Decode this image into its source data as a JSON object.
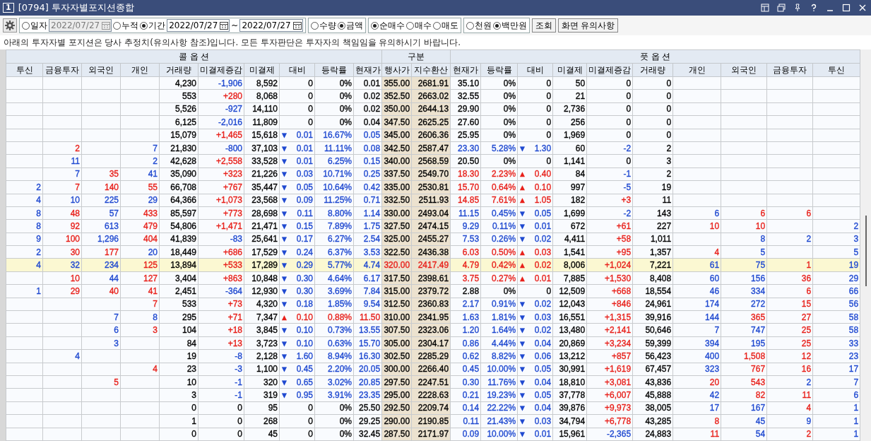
{
  "window": {
    "number": "1",
    "title": "[0794] 투자자별포지션종합"
  },
  "toolbar": {
    "groups": [
      {
        "items": [
          {
            "kind": "radio",
            "label": "일자",
            "selected": false
          },
          {
            "kind": "date",
            "value": "2022/07/27",
            "disabled": true
          },
          {
            "kind": "radio",
            "label": "누적",
            "selected": false
          },
          {
            "kind": "radio",
            "label": "기간",
            "selected": true
          },
          {
            "kind": "date",
            "value": "2022/07/27",
            "disabled": false
          },
          {
            "kind": "text",
            "label": "~"
          },
          {
            "kind": "date",
            "value": "2022/07/27",
            "disabled": false
          }
        ]
      },
      {
        "items": [
          {
            "kind": "radio",
            "label": "수량",
            "selected": false
          },
          {
            "kind": "radio",
            "label": "금액",
            "selected": true
          }
        ]
      },
      {
        "items": [
          {
            "kind": "radio",
            "label": "순매수",
            "selected": true
          },
          {
            "kind": "radio",
            "label": "매수",
            "selected": false
          },
          {
            "kind": "radio",
            "label": "매도",
            "selected": false
          }
        ]
      },
      {
        "items": [
          {
            "kind": "radio",
            "label": "천원",
            "selected": false
          },
          {
            "kind": "radio",
            "label": "백만원",
            "selected": true
          }
        ]
      }
    ],
    "buttons": [
      "조회",
      "화면 유의사항"
    ]
  },
  "notice": "아래의 투자자별 포지션은 당사 추정치(유의사항 참조)입니다. 모든 투자판단은 투자자의 책임임을 유의하시기 바랍니다.",
  "table": {
    "column_groups": [
      {
        "label": "콜 옵 션",
        "kind": "side",
        "columns": [
          "투신",
          "금융투자",
          "외국인",
          "개인",
          "거래량",
          "미결제증감",
          "미결제",
          "대비",
          "등락률",
          "현재가"
        ]
      },
      {
        "label": "구분",
        "kind": "strike",
        "columns": [
          "행사가",
          "지수환산"
        ]
      },
      {
        "label": "풋 옵 션",
        "kind": "side",
        "columns": [
          "현재가",
          "등락률",
          "대비",
          "미결제",
          "미결제증감",
          "거래량",
          "개인",
          "외국인",
          "금융투자",
          "투신"
        ]
      }
    ],
    "rows": [
      {
        "selected": false,
        "cells": [
          null,
          null,
          null,
          null,
          "4,230",
          {
            "text": "-1,906",
            "color": "#1f49d0"
          },
          "8,592",
          "0",
          "0%",
          "0.01",
          "355.00",
          "2681.91",
          "35.10",
          "0%",
          "0",
          "50",
          "0",
          "0",
          null,
          null,
          null,
          null
        ]
      },
      {
        "selected": false,
        "cells": [
          null,
          null,
          null,
          null,
          "553",
          {
            "text": "+280",
            "color": "#e8201a"
          },
          "8,068",
          "0",
          "0%",
          "0.02",
          "352.50",
          "2663.02",
          "32.55",
          "0%",
          "0",
          "21",
          "0",
          "0",
          null,
          null,
          null,
          null
        ]
      },
      {
        "selected": false,
        "cells": [
          null,
          null,
          null,
          null,
          "5,526",
          {
            "text": "-927",
            "color": "#1f49d0"
          },
          "14,110",
          "0",
          "0%",
          "0.02",
          "350.00",
          "2644.13",
          "29.90",
          "0%",
          "0",
          "2,736",
          "0",
          "0",
          null,
          null,
          null,
          null
        ]
      },
      {
        "selected": false,
        "cells": [
          null,
          null,
          null,
          null,
          "6,125",
          {
            "text": "-2,016",
            "color": "#1f49d0"
          },
          "11,809",
          "0",
          "0%",
          "0.04",
          "347.50",
          "2625.25",
          "27.60",
          "0%",
          "0",
          "256",
          "0",
          "0",
          null,
          null,
          null,
          null
        ]
      },
      {
        "selected": false,
        "cells": [
          null,
          null,
          null,
          null,
          "15,079",
          {
            "text": "+1,465",
            "color": "#e8201a"
          },
          "15,618",
          {
            "text": "0.01",
            "color": "#1f49d0",
            "arrow": "▼"
          },
          {
            "text": "16.67%",
            "color": "#1f49d0"
          },
          {
            "text": "0.05",
            "color": "#1f49d0"
          },
          "345.00",
          "2606.36",
          "25.95",
          "0%",
          "0",
          "1,969",
          "0",
          "0",
          null,
          null,
          null,
          null
        ]
      },
      {
        "selected": false,
        "cells": [
          null,
          {
            "text": "2",
            "color": "#e8201a"
          },
          null,
          {
            "text": "7",
            "color": "#1f49d0"
          },
          "21,830",
          {
            "text": "-800",
            "color": "#1f49d0"
          },
          "37,103",
          {
            "text": "0.01",
            "color": "#1f49d0",
            "arrow": "▼"
          },
          {
            "text": "11.11%",
            "color": "#1f49d0"
          },
          {
            "text": "0.08",
            "color": "#1f49d0"
          },
          "342.50",
          "2587.47",
          {
            "text": "23.30",
            "color": "#1f49d0"
          },
          {
            "text": "5.28%",
            "color": "#1f49d0"
          },
          {
            "text": "1.30",
            "color": "#1f49d0",
            "arrow": "▼"
          },
          "60",
          {
            "text": "-2",
            "color": "#1f49d0"
          },
          "2",
          null,
          null,
          null,
          null
        ]
      },
      {
        "selected": false,
        "cells": [
          null,
          {
            "text": "11",
            "color": "#1f49d0"
          },
          null,
          {
            "text": "2",
            "color": "#1f49d0"
          },
          "42,628",
          {
            "text": "+2,558",
            "color": "#e8201a"
          },
          "33,528",
          {
            "text": "0.01",
            "color": "#1f49d0",
            "arrow": "▼"
          },
          {
            "text": "6.25%",
            "color": "#1f49d0"
          },
          {
            "text": "0.15",
            "color": "#1f49d0"
          },
          "340.00",
          "2568.59",
          "20.50",
          "0%",
          "0",
          "1,141",
          "0",
          "3",
          null,
          null,
          null,
          null
        ]
      },
      {
        "selected": false,
        "cells": [
          null,
          {
            "text": "7",
            "color": "#1f49d0"
          },
          {
            "text": "35",
            "color": "#e8201a"
          },
          {
            "text": "41",
            "color": "#1f49d0"
          },
          "35,090",
          {
            "text": "+323",
            "color": "#e8201a"
          },
          "21,226",
          {
            "text": "0.03",
            "color": "#1f49d0",
            "arrow": "▼"
          },
          {
            "text": "10.71%",
            "color": "#1f49d0"
          },
          {
            "text": "0.25",
            "color": "#1f49d0"
          },
          "337.50",
          "2549.70",
          {
            "text": "18.30",
            "color": "#e8201a"
          },
          {
            "text": "2.23%",
            "color": "#e8201a"
          },
          {
            "text": "0.40",
            "color": "#e8201a",
            "arrow": "▲"
          },
          "84",
          {
            "text": "-1",
            "color": "#1f49d0"
          },
          "2",
          null,
          null,
          null,
          null
        ]
      },
      {
        "selected": false,
        "cells": [
          {
            "text": "2",
            "color": "#1f49d0"
          },
          {
            "text": "7",
            "color": "#e8201a"
          },
          {
            "text": "140",
            "color": "#e8201a"
          },
          {
            "text": "55",
            "color": "#e8201a"
          },
          "66,708",
          {
            "text": "+767",
            "color": "#e8201a"
          },
          "35,447",
          {
            "text": "0.05",
            "color": "#1f49d0",
            "arrow": "▼"
          },
          {
            "text": "10.64%",
            "color": "#1f49d0"
          },
          {
            "text": "0.42",
            "color": "#1f49d0"
          },
          "335.00",
          "2530.81",
          {
            "text": "15.70",
            "color": "#e8201a"
          },
          {
            "text": "0.64%",
            "color": "#e8201a"
          },
          {
            "text": "0.10",
            "color": "#e8201a",
            "arrow": "▲"
          },
          "997",
          {
            "text": "-5",
            "color": "#1f49d0"
          },
          "19",
          null,
          null,
          null,
          null
        ]
      },
      {
        "selected": false,
        "cells": [
          {
            "text": "4",
            "color": "#1f49d0"
          },
          {
            "text": "10",
            "color": "#1f49d0"
          },
          {
            "text": "225",
            "color": "#1f49d0"
          },
          {
            "text": "29",
            "color": "#1f49d0"
          },
          "64,366",
          {
            "text": "+1,073",
            "color": "#e8201a"
          },
          "23,568",
          {
            "text": "0.09",
            "color": "#1f49d0",
            "arrow": "▼"
          },
          {
            "text": "11.25%",
            "color": "#1f49d0"
          },
          {
            "text": "0.71",
            "color": "#1f49d0"
          },
          "332.50",
          "2511.93",
          {
            "text": "14.85",
            "color": "#e8201a"
          },
          {
            "text": "7.61%",
            "color": "#e8201a"
          },
          {
            "text": "1.05",
            "color": "#e8201a",
            "arrow": "▲"
          },
          "182",
          {
            "text": "+3",
            "color": "#e8201a"
          },
          "11",
          null,
          null,
          null,
          null
        ]
      },
      {
        "selected": false,
        "cells": [
          {
            "text": "8",
            "color": "#1f49d0"
          },
          {
            "text": "48",
            "color": "#e8201a"
          },
          {
            "text": "57",
            "color": "#1f49d0"
          },
          {
            "text": "433",
            "color": "#e8201a"
          },
          "85,597",
          {
            "text": "+773",
            "color": "#e8201a"
          },
          "28,698",
          {
            "text": "0.11",
            "color": "#1f49d0",
            "arrow": "▼"
          },
          {
            "text": "8.80%",
            "color": "#1f49d0"
          },
          {
            "text": "1.14",
            "color": "#1f49d0"
          },
          "330.00",
          "2493.04",
          {
            "text": "11.15",
            "color": "#1f49d0"
          },
          {
            "text": "0.45%",
            "color": "#1f49d0"
          },
          {
            "text": "0.05",
            "color": "#1f49d0",
            "arrow": "▼"
          },
          "1,699",
          {
            "text": "-2",
            "color": "#1f49d0"
          },
          "143",
          {
            "text": "6",
            "color": "#1f49d0"
          },
          {
            "text": "6",
            "color": "#e8201a"
          },
          {
            "text": "6",
            "color": "#e8201a"
          },
          null
        ]
      },
      {
        "selected": false,
        "cells": [
          {
            "text": "8",
            "color": "#1f49d0"
          },
          {
            "text": "92",
            "color": "#e8201a"
          },
          {
            "text": "613",
            "color": "#1f49d0"
          },
          {
            "text": "479",
            "color": "#e8201a"
          },
          "54,806",
          {
            "text": "+1,471",
            "color": "#e8201a"
          },
          "21,471",
          {
            "text": "0.15",
            "color": "#1f49d0",
            "arrow": "▼"
          },
          {
            "text": "7.89%",
            "color": "#1f49d0"
          },
          {
            "text": "1.75",
            "color": "#1f49d0"
          },
          "327.50",
          "2474.15",
          {
            "text": "9.29",
            "color": "#1f49d0"
          },
          {
            "text": "0.11%",
            "color": "#1f49d0"
          },
          {
            "text": "0.01",
            "color": "#1f49d0",
            "arrow": "▼"
          },
          "672",
          {
            "text": "+61",
            "color": "#e8201a"
          },
          "227",
          {
            "text": "10",
            "color": "#e8201a"
          },
          {
            "text": "10",
            "color": "#e8201a"
          },
          null,
          {
            "text": "2",
            "color": "#1f49d0"
          }
        ]
      },
      {
        "selected": false,
        "cells": [
          {
            "text": "9",
            "color": "#1f49d0"
          },
          {
            "text": "100",
            "color": "#e8201a"
          },
          {
            "text": "1,296",
            "color": "#1f49d0"
          },
          {
            "text": "404",
            "color": "#e8201a"
          },
          "41,839",
          {
            "text": "-83",
            "color": "#1f49d0"
          },
          "25,641",
          {
            "text": "0.17",
            "color": "#1f49d0",
            "arrow": "▼"
          },
          {
            "text": "6.27%",
            "color": "#1f49d0"
          },
          {
            "text": "2.54",
            "color": "#1f49d0"
          },
          "325.00",
          "2455.27",
          {
            "text": "7.53",
            "color": "#1f49d0"
          },
          {
            "text": "0.26%",
            "color": "#1f49d0"
          },
          {
            "text": "0.02",
            "color": "#1f49d0",
            "arrow": "▼"
          },
          "4,411",
          {
            "text": "+58",
            "color": "#e8201a"
          },
          "1,011",
          null,
          {
            "text": "8",
            "color": "#1f49d0"
          },
          {
            "text": "2",
            "color": "#1f49d0"
          },
          {
            "text": "3",
            "color": "#1f49d0"
          }
        ]
      },
      {
        "selected": false,
        "cells": [
          {
            "text": "2",
            "color": "#1f49d0"
          },
          {
            "text": "30",
            "color": "#e8201a"
          },
          {
            "text": "177",
            "color": "#e8201a"
          },
          {
            "text": "20",
            "color": "#1f49d0"
          },
          "18,449",
          {
            "text": "+686",
            "color": "#e8201a"
          },
          "17,529",
          {
            "text": "0.24",
            "color": "#1f49d0",
            "arrow": "▼"
          },
          {
            "text": "6.37%",
            "color": "#1f49d0"
          },
          {
            "text": "3.53",
            "color": "#1f49d0"
          },
          "322.50",
          "2436.38",
          {
            "text": "6.03",
            "color": "#e8201a"
          },
          {
            "text": "0.50%",
            "color": "#e8201a"
          },
          {
            "text": "0.03",
            "color": "#e8201a",
            "arrow": "▲"
          },
          "1,541",
          {
            "text": "+95",
            "color": "#e8201a"
          },
          "1,357",
          {
            "text": "4",
            "color": "#e8201a"
          },
          {
            "text": "5",
            "color": "#1f49d0"
          },
          null,
          {
            "text": "5",
            "color": "#1f49d0"
          }
        ]
      },
      {
        "selected": true,
        "cells": [
          {
            "text": "4",
            "color": "#1f49d0"
          },
          {
            "text": "32",
            "color": "#1f49d0"
          },
          {
            "text": "234",
            "color": "#1f49d0"
          },
          {
            "text": "125",
            "color": "#e8201a"
          },
          "13,894",
          {
            "text": "+533",
            "color": "#e8201a"
          },
          "17,289",
          {
            "text": "0.29",
            "color": "#1f49d0",
            "arrow": "▼"
          },
          {
            "text": "5.77%",
            "color": "#1f49d0"
          },
          {
            "text": "4.74",
            "color": "#1f49d0"
          },
          {
            "text": "320.00",
            "color": "#e8201a"
          },
          {
            "text": "2417.49",
            "color": "#e8201a"
          },
          {
            "text": "4.79",
            "color": "#e8201a"
          },
          {
            "text": "0.42%",
            "color": "#e8201a"
          },
          {
            "text": "0.02",
            "color": "#e8201a",
            "arrow": "▲"
          },
          "8,006",
          {
            "text": "+1,024",
            "color": "#e8201a"
          },
          "7,221",
          {
            "text": "61",
            "color": "#1f49d0"
          },
          {
            "text": "75",
            "color": "#1f49d0"
          },
          {
            "text": "1",
            "color": "#e8201a"
          },
          {
            "text": "19",
            "color": "#1f49d0"
          }
        ]
      },
      {
        "selected": false,
        "cells": [
          null,
          {
            "text": "10",
            "color": "#e8201a"
          },
          {
            "text": "44",
            "color": "#1f49d0"
          },
          {
            "text": "127",
            "color": "#e8201a"
          },
          "3,404",
          {
            "text": "+863",
            "color": "#e8201a"
          },
          "10,848",
          {
            "text": "0.30",
            "color": "#1f49d0",
            "arrow": "▼"
          },
          {
            "text": "4.64%",
            "color": "#1f49d0"
          },
          {
            "text": "6.17",
            "color": "#1f49d0"
          },
          "317.50",
          "2398.61",
          {
            "text": "3.75",
            "color": "#e8201a"
          },
          {
            "text": "0.27%",
            "color": "#e8201a"
          },
          {
            "text": "0.01",
            "color": "#e8201a",
            "arrow": "▲"
          },
          "7,885",
          {
            "text": "+1,530",
            "color": "#e8201a"
          },
          "8,408",
          {
            "text": "60",
            "color": "#1f49d0"
          },
          {
            "text": "156",
            "color": "#1f49d0"
          },
          {
            "text": "36",
            "color": "#e8201a"
          },
          {
            "text": "29",
            "color": "#1f49d0"
          }
        ]
      },
      {
        "selected": false,
        "cells": [
          {
            "text": "1",
            "color": "#1f49d0"
          },
          {
            "text": "29",
            "color": "#e8201a"
          },
          {
            "text": "40",
            "color": "#e8201a"
          },
          {
            "text": "41",
            "color": "#e8201a"
          },
          "2,451",
          {
            "text": "-364",
            "color": "#1f49d0"
          },
          "12,930",
          {
            "text": "0.30",
            "color": "#1f49d0",
            "arrow": "▼"
          },
          {
            "text": "3.69%",
            "color": "#1f49d0"
          },
          {
            "text": "7.84",
            "color": "#1f49d0"
          },
          "315.00",
          "2379.72",
          "2.88",
          "0%",
          "0",
          "12,509",
          {
            "text": "+668",
            "color": "#e8201a"
          },
          "18,554",
          {
            "text": "46",
            "color": "#1f49d0"
          },
          {
            "text": "334",
            "color": "#1f49d0"
          },
          {
            "text": "6",
            "color": "#e8201a"
          },
          {
            "text": "66",
            "color": "#1f49d0"
          }
        ]
      },
      {
        "selected": false,
        "cells": [
          null,
          null,
          null,
          {
            "text": "7",
            "color": "#e8201a"
          },
          "533",
          {
            "text": "+73",
            "color": "#e8201a"
          },
          "4,320",
          {
            "text": "0.18",
            "color": "#1f49d0",
            "arrow": "▼"
          },
          {
            "text": "1.85%",
            "color": "#1f49d0"
          },
          {
            "text": "9.54",
            "color": "#1f49d0"
          },
          "312.50",
          "2360.83",
          {
            "text": "2.17",
            "color": "#1f49d0"
          },
          {
            "text": "0.91%",
            "color": "#1f49d0"
          },
          {
            "text": "0.02",
            "color": "#1f49d0",
            "arrow": "▼"
          },
          "12,043",
          {
            "text": "+846",
            "color": "#e8201a"
          },
          "24,961",
          {
            "text": "174",
            "color": "#1f49d0"
          },
          {
            "text": "272",
            "color": "#1f49d0"
          },
          {
            "text": "15",
            "color": "#e8201a"
          },
          {
            "text": "56",
            "color": "#1f49d0"
          }
        ]
      },
      {
        "selected": false,
        "cells": [
          null,
          null,
          {
            "text": "7",
            "color": "#1f49d0"
          },
          {
            "text": "8",
            "color": "#1f49d0"
          },
          "295",
          {
            "text": "+71",
            "color": "#e8201a"
          },
          "7,347",
          {
            "text": "0.10",
            "color": "#e8201a",
            "arrow": "▲"
          },
          {
            "text": "0.88%",
            "color": "#e8201a"
          },
          {
            "text": "11.50",
            "color": "#e8201a"
          },
          "310.00",
          "2341.95",
          {
            "text": "1.63",
            "color": "#1f49d0"
          },
          {
            "text": "1.81%",
            "color": "#1f49d0"
          },
          {
            "text": "0.03",
            "color": "#1f49d0",
            "arrow": "▼"
          },
          "16,551",
          {
            "text": "+1,315",
            "color": "#e8201a"
          },
          "39,916",
          {
            "text": "144",
            "color": "#1f49d0"
          },
          {
            "text": "365",
            "color": "#e8201a"
          },
          {
            "text": "27",
            "color": "#e8201a"
          },
          {
            "text": "58",
            "color": "#1f49d0"
          }
        ]
      },
      {
        "selected": false,
        "cells": [
          null,
          null,
          {
            "text": "6",
            "color": "#1f49d0"
          },
          {
            "text": "3",
            "color": "#e8201a"
          },
          "104",
          {
            "text": "+18",
            "color": "#e8201a"
          },
          "3,845",
          {
            "text": "0.10",
            "color": "#1f49d0",
            "arrow": "▼"
          },
          {
            "text": "0.73%",
            "color": "#1f49d0"
          },
          {
            "text": "13.55",
            "color": "#1f49d0"
          },
          "307.50",
          "2323.06",
          {
            "text": "1.20",
            "color": "#1f49d0"
          },
          {
            "text": "1.64%",
            "color": "#1f49d0"
          },
          {
            "text": "0.02",
            "color": "#1f49d0",
            "arrow": "▼"
          },
          "13,480",
          {
            "text": "+2,141",
            "color": "#e8201a"
          },
          "50,646",
          {
            "text": "7",
            "color": "#1f49d0"
          },
          {
            "text": "747",
            "color": "#1f49d0"
          },
          {
            "text": "25",
            "color": "#e8201a"
          },
          {
            "text": "58",
            "color": "#1f49d0"
          }
        ]
      },
      {
        "selected": false,
        "cells": [
          null,
          null,
          {
            "text": "3",
            "color": "#1f49d0"
          },
          null,
          "84",
          {
            "text": "+13",
            "color": "#e8201a"
          },
          "3,723",
          {
            "text": "0.10",
            "color": "#1f49d0",
            "arrow": "▼"
          },
          {
            "text": "0.63%",
            "color": "#1f49d0"
          },
          {
            "text": "15.70",
            "color": "#1f49d0"
          },
          "305.00",
          "2304.17",
          {
            "text": "0.86",
            "color": "#1f49d0"
          },
          {
            "text": "4.44%",
            "color": "#1f49d0"
          },
          {
            "text": "0.04",
            "color": "#1f49d0",
            "arrow": "▼"
          },
          "20,869",
          {
            "text": "+3,234",
            "color": "#e8201a"
          },
          "59,399",
          {
            "text": "394",
            "color": "#1f49d0"
          },
          {
            "text": "195",
            "color": "#1f49d0"
          },
          {
            "text": "25",
            "color": "#e8201a"
          },
          {
            "text": "33",
            "color": "#1f49d0"
          }
        ]
      },
      {
        "selected": false,
        "cells": [
          null,
          {
            "text": "4",
            "color": "#1f49d0"
          },
          null,
          null,
          "19",
          {
            "text": "-8",
            "color": "#1f49d0"
          },
          "2,128",
          {
            "text": "1.60",
            "color": "#1f49d0",
            "arrow": "▼"
          },
          {
            "text": "8.94%",
            "color": "#1f49d0"
          },
          {
            "text": "16.30",
            "color": "#1f49d0"
          },
          "302.50",
          "2285.29",
          {
            "text": "0.62",
            "color": "#1f49d0"
          },
          {
            "text": "8.82%",
            "color": "#1f49d0"
          },
          {
            "text": "0.06",
            "color": "#1f49d0",
            "arrow": "▼"
          },
          "13,212",
          {
            "text": "+857",
            "color": "#e8201a"
          },
          "56,423",
          {
            "text": "400",
            "color": "#1f49d0"
          },
          {
            "text": "1,508",
            "color": "#e8201a"
          },
          {
            "text": "12",
            "color": "#e8201a"
          },
          {
            "text": "23",
            "color": "#1f49d0"
          }
        ]
      },
      {
        "selected": false,
        "cells": [
          null,
          null,
          null,
          {
            "text": "4",
            "color": "#e8201a"
          },
          "23",
          {
            "text": "-3",
            "color": "#1f49d0"
          },
          "1,100",
          {
            "text": "0.45",
            "color": "#1f49d0",
            "arrow": "▼"
          },
          {
            "text": "2.20%",
            "color": "#1f49d0"
          },
          {
            "text": "20.05",
            "color": "#1f49d0"
          },
          "300.00",
          "2266.40",
          {
            "text": "0.45",
            "color": "#1f49d0"
          },
          {
            "text": "10.00%",
            "color": "#1f49d0"
          },
          {
            "text": "0.05",
            "color": "#1f49d0",
            "arrow": "▼"
          },
          "30,991",
          {
            "text": "+1,619",
            "color": "#e8201a"
          },
          "67,457",
          {
            "text": "323",
            "color": "#1f49d0"
          },
          {
            "text": "767",
            "color": "#e8201a"
          },
          {
            "text": "16",
            "color": "#e8201a"
          },
          {
            "text": "17",
            "color": "#1f49d0"
          }
        ]
      },
      {
        "selected": false,
        "cells": [
          null,
          null,
          {
            "text": "5",
            "color": "#e8201a"
          },
          null,
          "10",
          {
            "text": "-1",
            "color": "#1f49d0"
          },
          "320",
          {
            "text": "0.65",
            "color": "#1f49d0",
            "arrow": "▼"
          },
          {
            "text": "3.02%",
            "color": "#1f49d0"
          },
          {
            "text": "20.85",
            "color": "#1f49d0"
          },
          "297.50",
          "2247.51",
          {
            "text": "0.30",
            "color": "#1f49d0"
          },
          {
            "text": "11.76%",
            "color": "#1f49d0"
          },
          {
            "text": "0.04",
            "color": "#1f49d0",
            "arrow": "▼"
          },
          "18,810",
          {
            "text": "+3,081",
            "color": "#e8201a"
          },
          "43,836",
          {
            "text": "20",
            "color": "#e8201a"
          },
          {
            "text": "543",
            "color": "#e8201a"
          },
          {
            "text": "2",
            "color": "#1f49d0"
          },
          {
            "text": "7",
            "color": "#1f49d0"
          }
        ]
      },
      {
        "selected": false,
        "cells": [
          null,
          null,
          null,
          null,
          "3",
          {
            "text": "-1",
            "color": "#1f49d0"
          },
          "319",
          {
            "text": "0.95",
            "color": "#1f49d0",
            "arrow": "▼"
          },
          {
            "text": "3.91%",
            "color": "#1f49d0"
          },
          {
            "text": "23.35",
            "color": "#1f49d0"
          },
          "295.00",
          "2228.63",
          {
            "text": "0.21",
            "color": "#1f49d0"
          },
          {
            "text": "19.23%",
            "color": "#1f49d0"
          },
          {
            "text": "0.05",
            "color": "#1f49d0",
            "arrow": "▼"
          },
          "37,778",
          {
            "text": "+6,007",
            "color": "#e8201a"
          },
          "45,888",
          {
            "text": "42",
            "color": "#1f49d0"
          },
          {
            "text": "82",
            "color": "#e8201a"
          },
          {
            "text": "11",
            "color": "#e8201a"
          },
          {
            "text": "6",
            "color": "#1f49d0"
          }
        ]
      },
      {
        "selected": false,
        "cells": [
          null,
          null,
          null,
          null,
          "0",
          "0",
          "95",
          "0",
          "0%",
          "25.50",
          "292.50",
          "2209.74",
          {
            "text": "0.14",
            "color": "#1f49d0"
          },
          {
            "text": "22.22%",
            "color": "#1f49d0"
          },
          {
            "text": "0.04",
            "color": "#1f49d0",
            "arrow": "▼"
          },
          "39,876",
          {
            "text": "+9,973",
            "color": "#e8201a"
          },
          "38,005",
          {
            "text": "17",
            "color": "#1f49d0"
          },
          {
            "text": "167",
            "color": "#1f49d0"
          },
          {
            "text": "4",
            "color": "#e8201a"
          },
          {
            "text": "1",
            "color": "#1f49d0"
          }
        ]
      },
      {
        "selected": false,
        "cells": [
          null,
          null,
          null,
          null,
          "1",
          "0",
          "268",
          "0",
          "0%",
          "29.25",
          "290.00",
          "2190.85",
          {
            "text": "0.11",
            "color": "#1f49d0"
          },
          {
            "text": "21.43%",
            "color": "#1f49d0"
          },
          {
            "text": "0.03",
            "color": "#1f49d0",
            "arrow": "▼"
          },
          "34,794",
          {
            "text": "+6,778",
            "color": "#e8201a"
          },
          "43,285",
          {
            "text": "8",
            "color": "#e8201a"
          },
          {
            "text": "45",
            "color": "#1f49d0"
          },
          {
            "text": "9",
            "color": "#1f49d0"
          },
          {
            "text": "1",
            "color": "#1f49d0"
          }
        ]
      },
      {
        "selected": false,
        "cells": [
          null,
          null,
          null,
          null,
          "0",
          "0",
          "45",
          "0",
          "0%",
          "32.45",
          "287.50",
          "2171.97",
          {
            "text": "0.09",
            "color": "#1f49d0"
          },
          {
            "text": "10.00%",
            "color": "#1f49d0"
          },
          {
            "text": "0.01",
            "color": "#1f49d0",
            "arrow": "▼"
          },
          "15,961",
          {
            "text": "-2,365",
            "color": "#1f49d0"
          },
          "24,883",
          {
            "text": "11",
            "color": "#e8201a"
          },
          {
            "text": "54",
            "color": "#1f49d0"
          },
          {
            "text": "2",
            "color": "#e8201a"
          },
          {
            "text": "1",
            "color": "#1f49d0"
          }
        ]
      }
    ]
  }
}
